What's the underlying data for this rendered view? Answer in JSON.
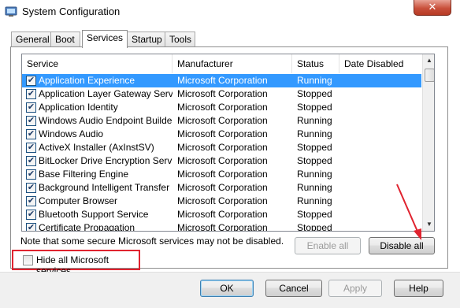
{
  "window": {
    "title": "System Configuration",
    "icon": "system-config-icon",
    "close_glyph": "✕"
  },
  "tabs": [
    {
      "label": "General",
      "active": false
    },
    {
      "label": "Boot",
      "active": false
    },
    {
      "label": "Services",
      "active": true
    },
    {
      "label": "Startup",
      "active": false
    },
    {
      "label": "Tools",
      "active": false
    }
  ],
  "services_table": {
    "columns": [
      "Service",
      "Manufacturer",
      "Status",
      "Date Disabled"
    ],
    "rows": [
      {
        "checked": true,
        "name": "Application Experience",
        "manufacturer": "Microsoft Corporation",
        "status": "Running",
        "date_disabled": "",
        "selected": true
      },
      {
        "checked": true,
        "name": "Application Layer Gateway Service",
        "manufacturer": "Microsoft Corporation",
        "status": "Stopped",
        "date_disabled": ""
      },
      {
        "checked": true,
        "name": "Application Identity",
        "manufacturer": "Microsoft Corporation",
        "status": "Stopped",
        "date_disabled": ""
      },
      {
        "checked": true,
        "name": "Windows Audio Endpoint Builder",
        "manufacturer": "Microsoft Corporation",
        "status": "Running",
        "date_disabled": ""
      },
      {
        "checked": true,
        "name": "Windows Audio",
        "manufacturer": "Microsoft Corporation",
        "status": "Running",
        "date_disabled": ""
      },
      {
        "checked": true,
        "name": "ActiveX Installer (AxInstSV)",
        "manufacturer": "Microsoft Corporation",
        "status": "Stopped",
        "date_disabled": ""
      },
      {
        "checked": true,
        "name": "BitLocker Drive Encryption Service",
        "manufacturer": "Microsoft Corporation",
        "status": "Stopped",
        "date_disabled": ""
      },
      {
        "checked": true,
        "name": "Base Filtering Engine",
        "manufacturer": "Microsoft Corporation",
        "status": "Running",
        "date_disabled": ""
      },
      {
        "checked": true,
        "name": "Background Intelligent Transfer ...",
        "manufacturer": "Microsoft Corporation",
        "status": "Running",
        "date_disabled": ""
      },
      {
        "checked": true,
        "name": "Computer Browser",
        "manufacturer": "Microsoft Corporation",
        "status": "Running",
        "date_disabled": ""
      },
      {
        "checked": true,
        "name": "Bluetooth Support Service",
        "manufacturer": "Microsoft Corporation",
        "status": "Stopped",
        "date_disabled": ""
      },
      {
        "checked": true,
        "name": "Certificate Propagation",
        "manufacturer": "Microsoft Corporation",
        "status": "Stopped",
        "date_disabled": ""
      }
    ]
  },
  "note": "Note that some secure Microsoft services may not be disabled.",
  "buttons": {
    "enable_all": "Enable all",
    "disable_all": "Disable all",
    "ok": "OK",
    "cancel": "Cancel",
    "apply": "Apply",
    "help": "Help"
  },
  "hide_ms": {
    "label": "Hide all Microsoft services",
    "checked": false
  },
  "check_glyph": "✔",
  "scroll": {
    "up_glyph": "▲",
    "down_glyph": "▼"
  },
  "colors": {
    "selection": "#3399ff",
    "annotation_red": "#e0232f"
  }
}
